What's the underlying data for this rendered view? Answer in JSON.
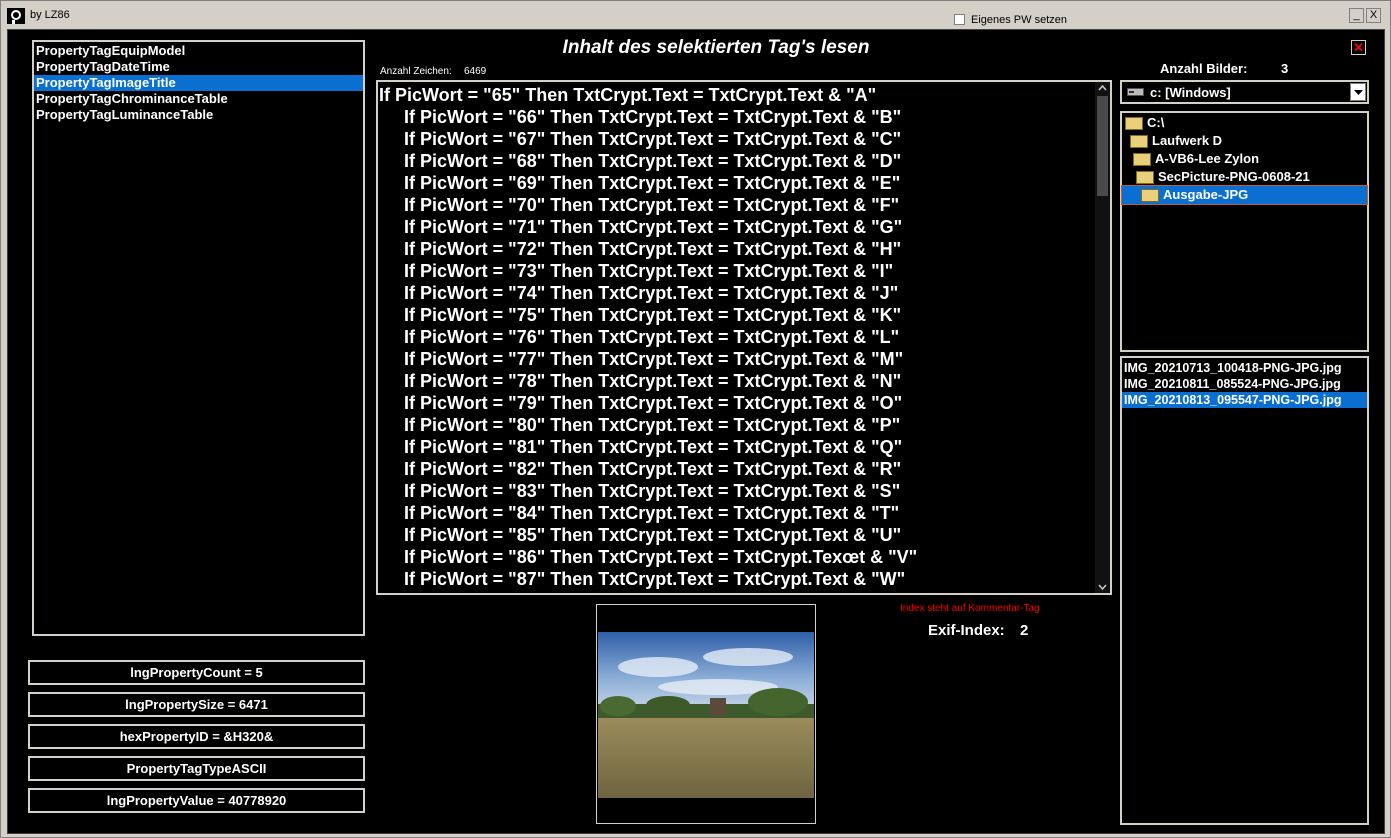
{
  "window": {
    "title": "by LZ86",
    "pw_checkbox_label": "Eigenes PW setzen",
    "minimize_glyph": "_",
    "close_glyph": "X"
  },
  "tags": {
    "items": [
      {
        "label": "PropertyTagEquipModel"
      },
      {
        "label": "PropertyTagDateTime"
      },
      {
        "label": "PropertyTagImageTitle",
        "selected": true
      },
      {
        "label": "PropertyTagChrominanceTable"
      },
      {
        "label": "PropertyTagLuminanceTable"
      }
    ]
  },
  "properties": {
    "count": "lngPropertyCount = 5",
    "size": "lngPropertySize = 6471",
    "hex_id": "hexPropertyID = &H320&",
    "type": "PropertyTagTypeASCII",
    "value": "lngPropertyValue = 40778920"
  },
  "main": {
    "heading": "Inhalt des selektierten Tag's lesen",
    "char_count_label": "Anzahl Zeichen:",
    "char_count": "6469",
    "code_lines": [
      "If PicWort = \"65\" Then TxtCrypt.Text = TxtCrypt.Text & \"A\"",
      "If PicWort = \"66\" Then TxtCrypt.Text = TxtCrypt.Text & \"B\"",
      "If PicWort = \"67\" Then TxtCrypt.Text = TxtCrypt.Text & \"C\"",
      "If PicWort = \"68\" Then TxtCrypt.Text = TxtCrypt.Text & \"D\"",
      "If PicWort = \"69\" Then TxtCrypt.Text = TxtCrypt.Text & \"E\"",
      "If PicWort = \"70\" Then TxtCrypt.Text = TxtCrypt.Text & \"F\"",
      "If PicWort = \"71\" Then TxtCrypt.Text = TxtCrypt.Text & \"G\"",
      "If PicWort = \"72\" Then TxtCrypt.Text = TxtCrypt.Text & \"H\"",
      "If PicWort = \"73\" Then TxtCrypt.Text = TxtCrypt.Text & \"I\"",
      "If PicWort = \"74\" Then TxtCrypt.Text = TxtCrypt.Text & \"J\"",
      "If PicWort = \"75\" Then TxtCrypt.Text = TxtCrypt.Text & \"K\"",
      "If PicWort = \"76\" Then TxtCrypt.Text = TxtCrypt.Text & \"L\"",
      "If PicWort = \"77\" Then TxtCrypt.Text = TxtCrypt.Text & \"M\"",
      "If PicWort = \"78\" Then TxtCrypt.Text = TxtCrypt.Text & \"N\"",
      "If PicWort = \"79\" Then TxtCrypt.Text = TxtCrypt.Text & \"O\"",
      "If PicWort = \"80\" Then TxtCrypt.Text = TxtCrypt.Text & \"P\"",
      "If PicWort = \"81\" Then TxtCrypt.Text = TxtCrypt.Text & \"Q\"",
      "If PicWort = \"82\" Then TxtCrypt.Text = TxtCrypt.Text & \"R\"",
      "If PicWort = \"83\" Then TxtCrypt.Text = TxtCrypt.Text & \"S\"",
      "If PicWort = \"84\" Then TxtCrypt.Text = TxtCrypt.Text & \"T\"",
      "If PicWort = \"85\" Then TxtCrypt.Text = TxtCrypt.Text & \"U\"",
      "If PicWort = \"86\" Then TxtCrypt.Text = TxtCrypt.Texœt & \"V\"",
      "If PicWort = \"87\" Then TxtCrypt.Text = TxtCrypt.Text & \"W\""
    ],
    "index_note": "Index steht auf Kommentar-Tag",
    "exif_label": "Exif-Index:",
    "exif_value": "2"
  },
  "right": {
    "image_count_label": "Anzahl Bilder:",
    "image_count": "3",
    "drive": "c: [Windows]",
    "folders": [
      {
        "label": "C:\\"
      },
      {
        "label": "Laufwerk  D"
      },
      {
        "label": "A-VB6-Lee Zylon"
      },
      {
        "label": "SecPicture-PNG-0608-21"
      },
      {
        "label": "Ausgabe-JPG",
        "selected": true
      }
    ],
    "files": [
      {
        "label": "IMG_20210713_100418-PNG-JPG.jpg"
      },
      {
        "label": "IMG_20210811_085524-PNG-JPG.jpg"
      },
      {
        "label": "IMG_20210813_095547-PNG-JPG.jpg",
        "selected": true
      }
    ]
  },
  "colors": {
    "selection": "#0a6fd1",
    "note_red": "#ff0000",
    "close_red": "#ff0000"
  }
}
